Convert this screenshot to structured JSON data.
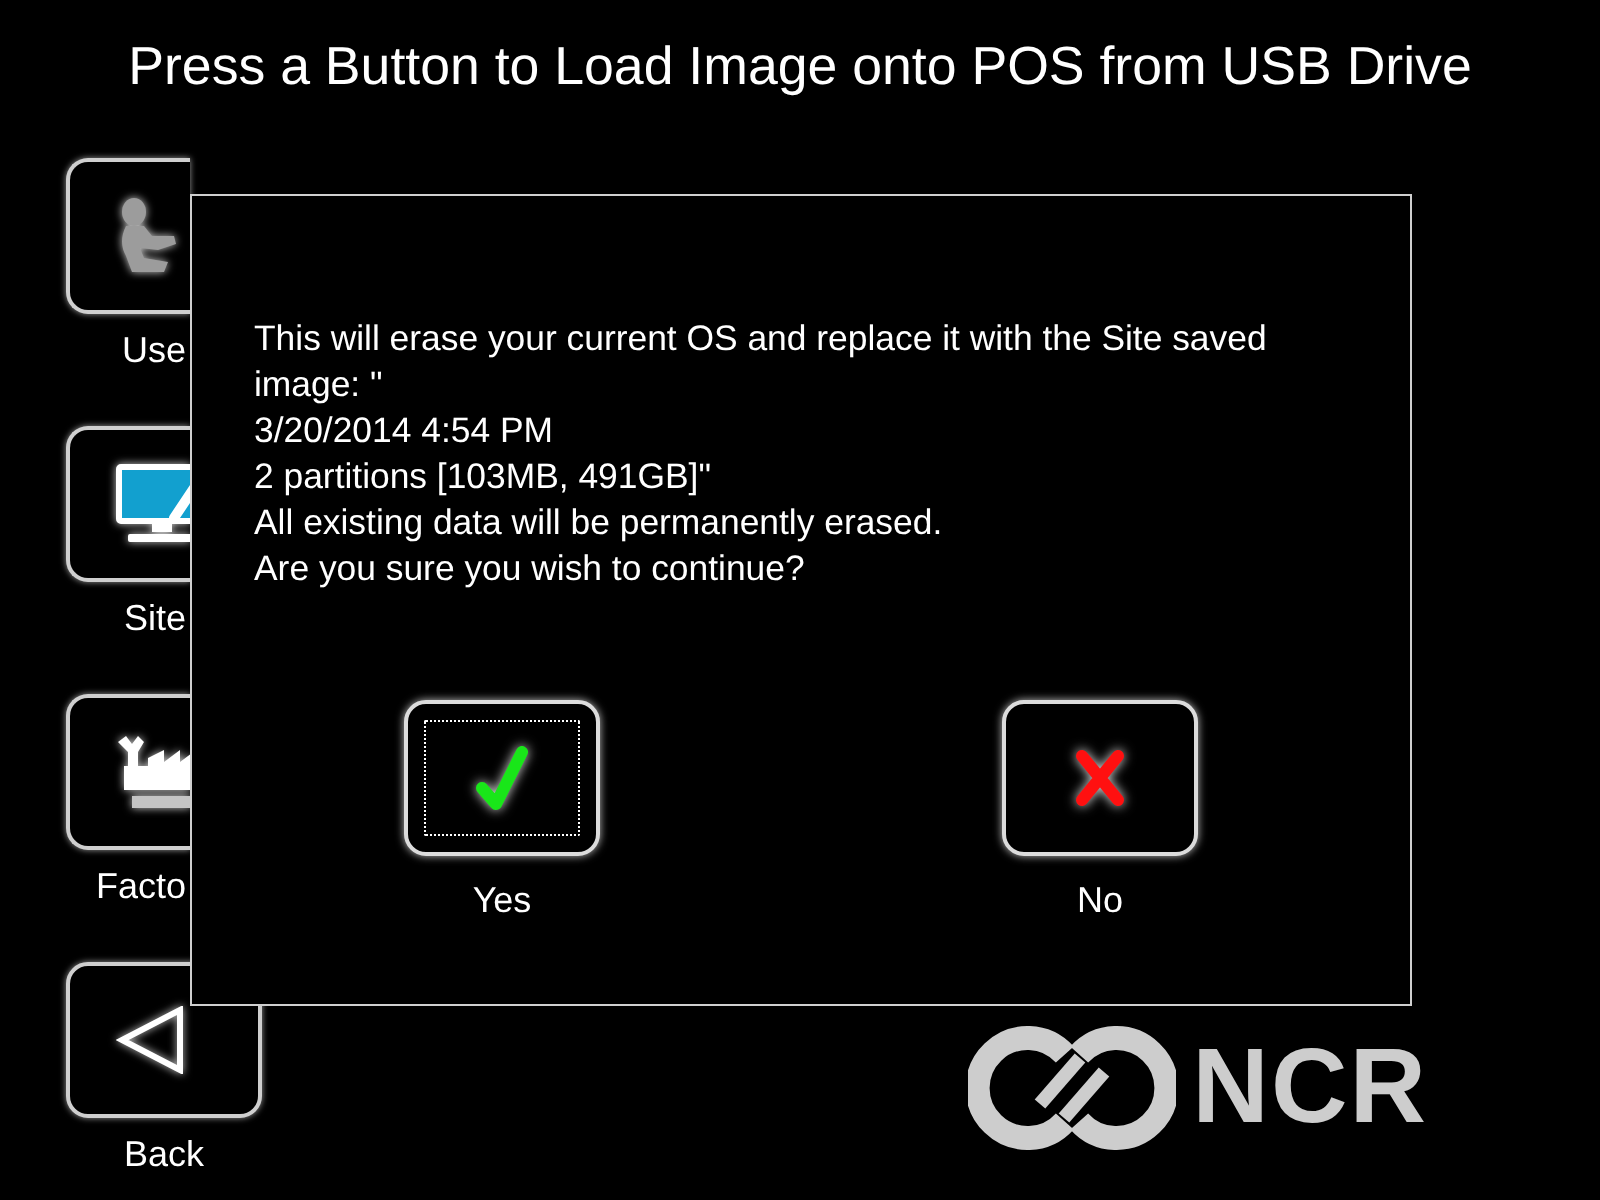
{
  "title": "Press a Button to Load Image onto POS from USB Drive",
  "nav": [
    {
      "kind": "user",
      "label": "Use",
      "covered": true
    },
    {
      "kind": "site",
      "label": "Site",
      "covered": true
    },
    {
      "kind": "factory",
      "label": "Facto",
      "covered": true
    },
    {
      "kind": "back",
      "label": "Back",
      "covered": false
    }
  ],
  "dialog": {
    "message": "This will erase your current OS and replace it with the Site saved image: \"\n3/20/2014 4:54 PM\n2 partitions [103MB, 491GB]\"\nAll existing data will be permanently erased.\nAre you sure you wish to continue?",
    "buttons": [
      {
        "kind": "confirm",
        "label": "Yes",
        "focused": true
      },
      {
        "kind": "cancel",
        "label": "No",
        "focused": false
      }
    ]
  },
  "logo": {
    "text": "NCR"
  }
}
